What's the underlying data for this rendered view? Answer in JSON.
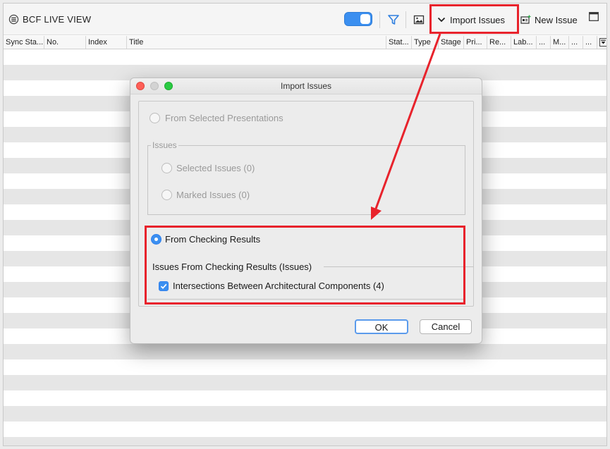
{
  "toolbar": {
    "title": "BCF LIVE VIEW",
    "import_label": "Import Issues",
    "new_issue_label": "New Issue",
    "toggle_on": true,
    "icons": [
      "bcf-logo-icon",
      "filter-icon",
      "image-icon",
      "chevron-down-icon",
      "new-issue-icon",
      "layout-icon"
    ]
  },
  "table": {
    "columns": [
      "Sync Sta...",
      "No.",
      "Index",
      "Title",
      "Stat...",
      "Type",
      "Stage",
      "Pri...",
      "Re...",
      "Lab...",
      "...",
      "M...",
      "...",
      "..."
    ]
  },
  "dialog": {
    "title": "Import Issues",
    "option_presentations": "From Selected Presentations",
    "issues_group_label": "Issues",
    "option_selected": "Selected Issues (0)",
    "option_marked": "Marked Issues (0)",
    "option_checking": "From Checking Results",
    "checking_group_label": "Issues From Checking Results (Issues)",
    "checkbox_intersections": "Intersections Between Architectural Components (4)",
    "ok_label": "OK",
    "cancel_label": "Cancel"
  },
  "colors": {
    "accent": "#3b8ff0",
    "highlight": "#e8232c",
    "filter_icon": "#2f7fe0"
  }
}
